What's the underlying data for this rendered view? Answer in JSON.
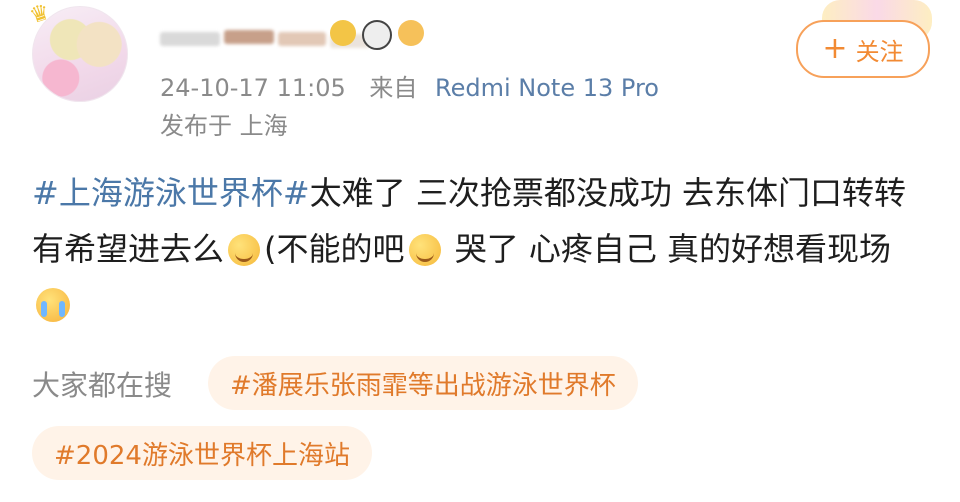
{
  "post": {
    "meta": {
      "time": "24-10-17 11:05",
      "from_label": "来自",
      "device": "Redmi Note 13 Pro",
      "location": "发布于 上海"
    },
    "follow": {
      "plus": "+",
      "label": "关注"
    },
    "content": {
      "topic": "#上海游泳世界杯#",
      "text1": "太难了 三次抢票都没成功 去东体门口转转有希望进去么",
      "text2": "(不能的吧",
      "text3": " 哭了 心疼自己 真的好想看现场"
    },
    "search": {
      "label": "大家都在搜",
      "tags": [
        "#潘展乐张雨霏等出战游泳世界杯",
        "#2024游泳世界杯上海站"
      ]
    }
  }
}
